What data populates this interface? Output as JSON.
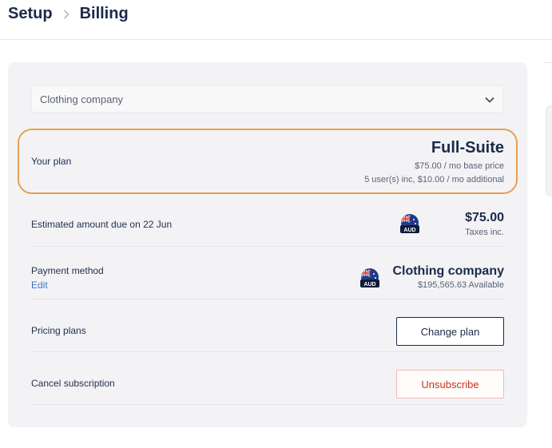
{
  "breadcrumb": {
    "root": "Setup",
    "current": "Billing"
  },
  "account_select": {
    "value": "Clothing company"
  },
  "plan": {
    "label": "Your plan",
    "name": "Full-Suite",
    "base_price": "$75.00 / mo base price",
    "users": "5 user(s) inc, $10.00 / mo additional"
  },
  "estimate": {
    "label": "Estimated amount due on 22 Jun",
    "currency": "AUD",
    "amount": "$75.00",
    "tax_note": "Taxes inc."
  },
  "payment": {
    "label": "Payment method",
    "edit_label": "Edit",
    "currency": "AUD",
    "account_name": "Clothing company",
    "available": "$195,565.63 Available"
  },
  "pricing": {
    "label": "Pricing plans",
    "button": "Change plan"
  },
  "cancel": {
    "label": "Cancel subscription",
    "button": "Unsubscribe"
  },
  "colors": {
    "accent": "#1b2a4a",
    "highlight": "#e8a04a",
    "danger": "#c8321e",
    "link": "#3d74c5"
  }
}
